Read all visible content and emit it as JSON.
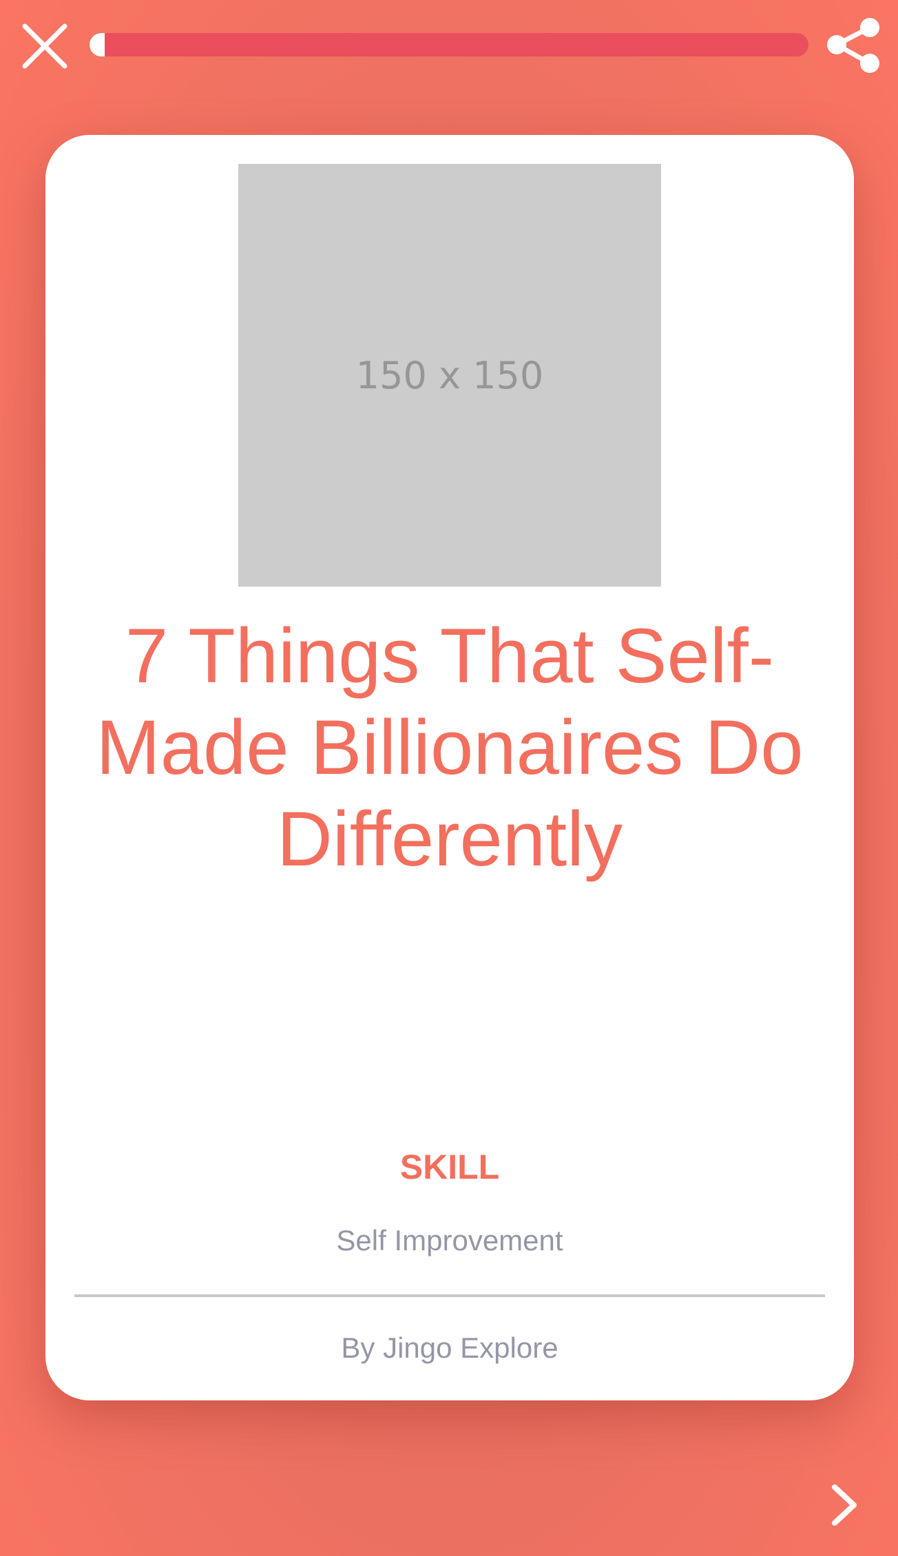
{
  "header": {
    "close_icon": "close-icon",
    "share_icon": "share-icon",
    "progress": 0.02,
    "progress_color": "#e94f5c"
  },
  "card": {
    "image_placeholder": "150 x 150",
    "title": "7 Things That Self-Made Billionaires Do Differently",
    "category": "SKILL",
    "subcategory": "Self Improvement",
    "author": "By Jingo Explore",
    "accent_color": "#f26f5e"
  },
  "footer": {
    "next_icon": "chevron-right-icon"
  },
  "colors": {
    "background": "#f97462",
    "card": "#ffffff",
    "muted_text": "#9496a6"
  }
}
